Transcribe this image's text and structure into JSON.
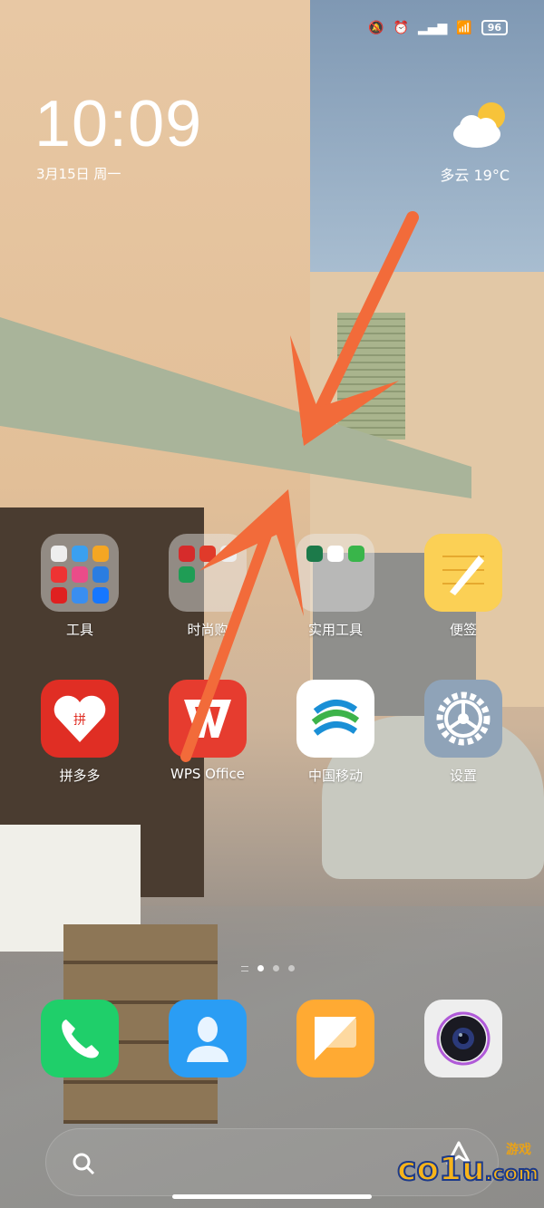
{
  "status_bar": {
    "icons": [
      "mute-bell-icon",
      "alarm-icon",
      "hd-signal-icon",
      "wifi-icon"
    ],
    "battery": "96"
  },
  "clock": {
    "time": "10:09",
    "date": "3月15日 周一"
  },
  "weather": {
    "icon": "partly-cloudy-icon",
    "text": "多云 19°C"
  },
  "apps": [
    {
      "label": "工具",
      "type": "folder"
    },
    {
      "label": "时尚购",
      "type": "folder"
    },
    {
      "label": "实用工具",
      "type": "folder"
    },
    {
      "label": "便签",
      "icon": "notes-icon",
      "color": "#f9c23c"
    },
    {
      "label": "拼多多",
      "icon": "pinduoduo-icon",
      "color": "#e02e24"
    },
    {
      "label": "WPS Office",
      "icon": "wps-icon",
      "color": "#e63c2f"
    },
    {
      "label": "中国移动",
      "icon": "china-mobile-icon",
      "color": "#ffffff"
    },
    {
      "label": "设置",
      "icon": "settings-gear-icon",
      "color": "#8fa3b8"
    }
  ],
  "dock": [
    {
      "icon": "phone-icon",
      "color": "#1fcf6a"
    },
    {
      "icon": "contacts-icon",
      "color": "#2a9df4"
    },
    {
      "icon": "messages-icon",
      "color": "#ffaa33"
    },
    {
      "icon": "camera-icon",
      "color": "#eeeeee"
    }
  ],
  "annotation": {
    "color": "#f26b3a"
  },
  "watermark": {
    "text": "co1u.com",
    "sub": "游戏"
  }
}
